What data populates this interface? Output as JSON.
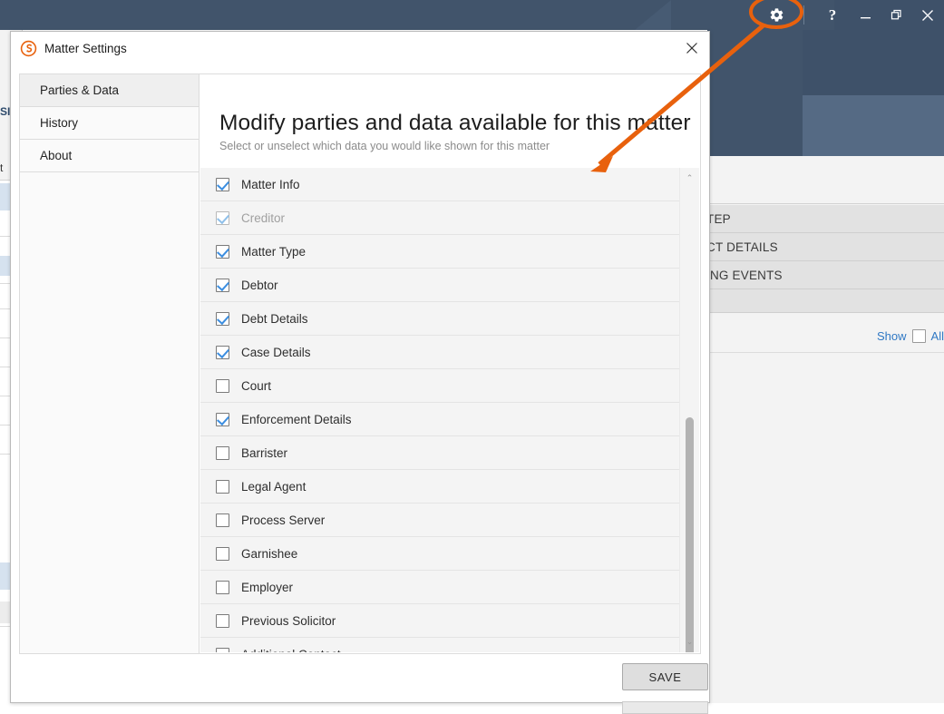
{
  "window": {
    "buttons": [
      {
        "name": "settings-gear",
        "icon": "gear-icon",
        "label": ""
      },
      {
        "name": "help",
        "icon": "question-mark-icon",
        "label": "?"
      },
      {
        "name": "minimize",
        "icon": "minimize-icon",
        "label": ""
      },
      {
        "name": "restore",
        "icon": "restore-icon",
        "label": ""
      },
      {
        "name": "close",
        "icon": "close-icon",
        "label": ""
      }
    ]
  },
  "background": {
    "left_fragments": [
      "SI",
      "t"
    ],
    "rows": [
      "TEP",
      "CT DETAILS",
      "ING EVENTS",
      ""
    ],
    "show_all": {
      "show_label": "Show",
      "all_label": "All"
    }
  },
  "dialog": {
    "title": "Matter Settings",
    "logo_icon": "swirl-s-logo-icon",
    "close_icon": "close-icon",
    "nav": [
      {
        "label": "Parties & Data",
        "selected": true
      },
      {
        "label": "History",
        "selected": false
      },
      {
        "label": "About",
        "selected": false
      }
    ],
    "heading": "Modify parties and data available for this matter",
    "subheading": "Select or unselect which data you would like shown for this matter",
    "items": [
      {
        "label": "Matter Info",
        "checked": true,
        "disabled": false
      },
      {
        "label": "Creditor",
        "checked": true,
        "disabled": true
      },
      {
        "label": "Matter Type",
        "checked": true,
        "disabled": false
      },
      {
        "label": "Debtor",
        "checked": true,
        "disabled": false
      },
      {
        "label": "Debt Details",
        "checked": true,
        "disabled": false
      },
      {
        "label": "Case Details",
        "checked": true,
        "disabled": false
      },
      {
        "label": "Court",
        "checked": false,
        "disabled": false
      },
      {
        "label": "Enforcement Details",
        "checked": true,
        "disabled": false
      },
      {
        "label": "Barrister",
        "checked": false,
        "disabled": false
      },
      {
        "label": "Legal Agent",
        "checked": false,
        "disabled": false
      },
      {
        "label": "Process Server",
        "checked": false,
        "disabled": false
      },
      {
        "label": "Garnishee",
        "checked": false,
        "disabled": false
      },
      {
        "label": "Employer",
        "checked": false,
        "disabled": false
      },
      {
        "label": "Previous Solicitor",
        "checked": false,
        "disabled": false
      },
      {
        "label": "Additional Contact",
        "checked": false,
        "disabled": false
      }
    ],
    "save_label": "SAVE",
    "scrollbar": {
      "up_glyph": "⌃",
      "down_glyph": "⌄"
    }
  },
  "annotation": {
    "color": "#E8610D",
    "shape": "ellipse-with-arrow",
    "target": "settings-gear-button"
  },
  "colors": {
    "titlebar": "#41546b",
    "titlebar_alt": "#3e5169",
    "accent_orange": "#E8610D",
    "checkbox_blue": "#3c8ee0",
    "link_blue": "#2f78c4"
  }
}
